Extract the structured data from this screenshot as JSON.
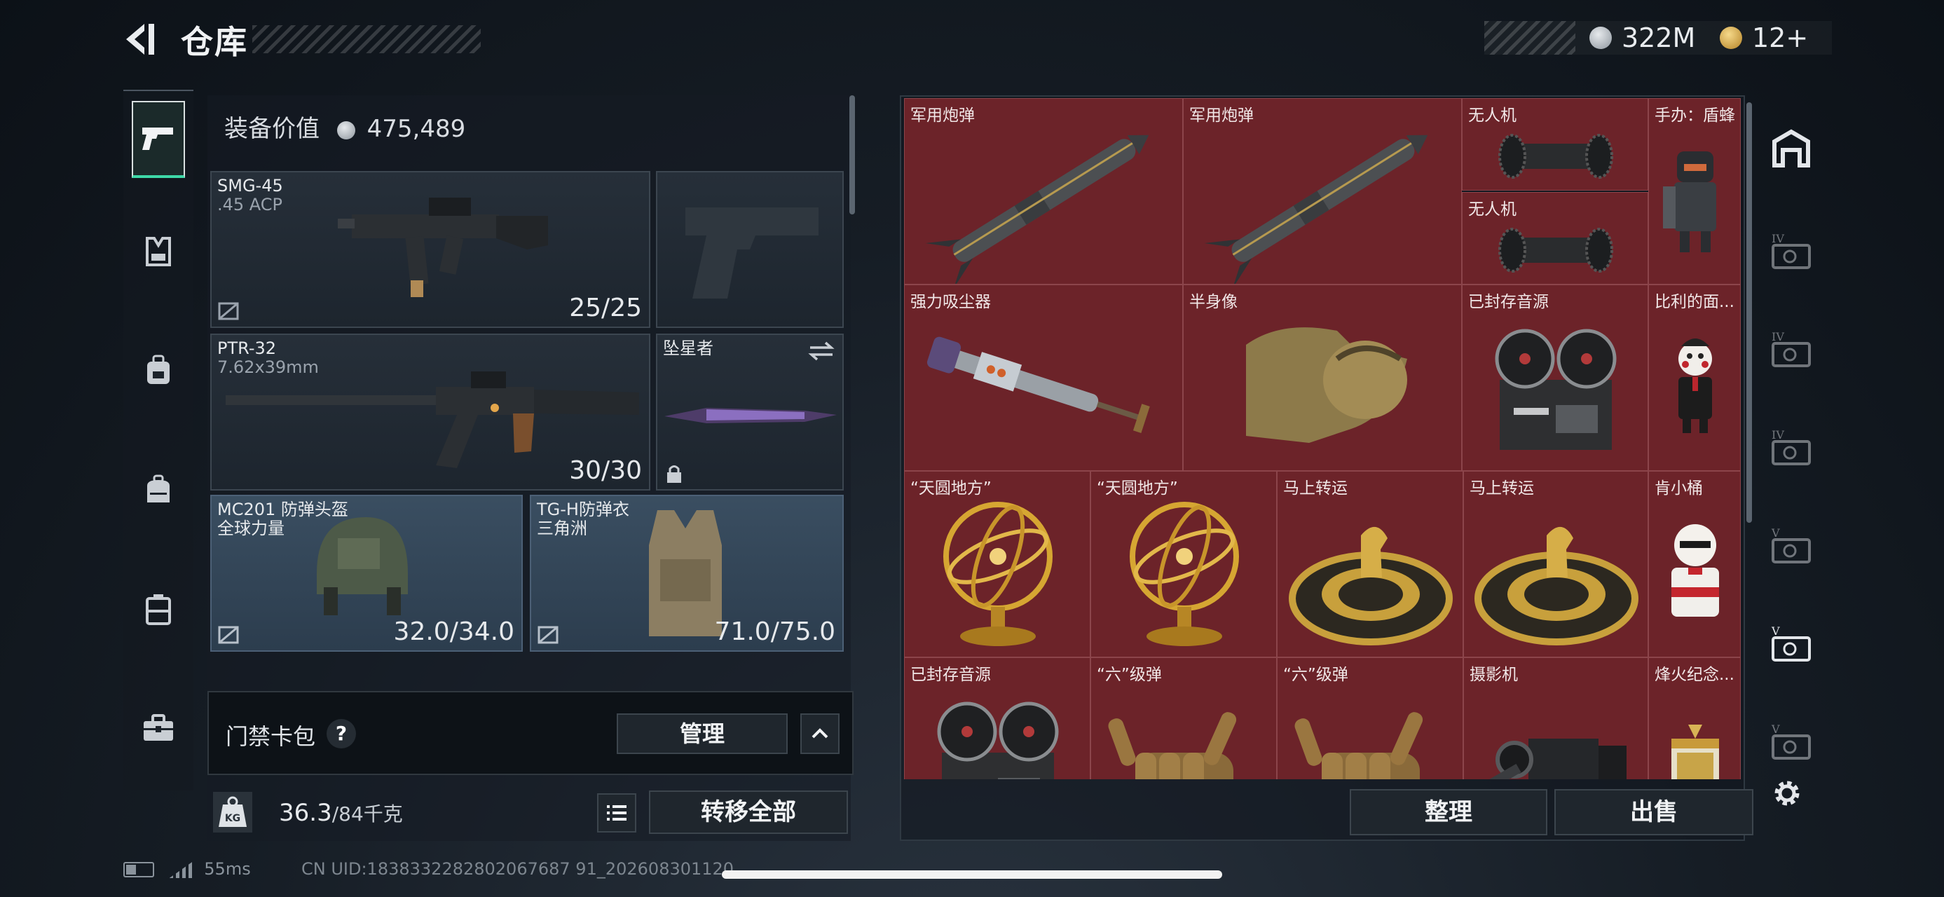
{
  "header": {
    "title": "仓库"
  },
  "currency": {
    "silver": "322M",
    "gold": "12+"
  },
  "colors": {
    "accent_green": "#3ed9a8",
    "item_red": "#6c2329",
    "slot_blue": "#3a4e61"
  },
  "left_nav": {
    "items": [
      "pistol-icon",
      "armor-icon",
      "backpack-icon",
      "bag-icon",
      "case-icon",
      "toolbox-icon"
    ],
    "active": "pistol-icon"
  },
  "equipment": {
    "value_label": "装备价值",
    "value": "475,489",
    "slots": [
      {
        "name": "SMG-45",
        "sub": ".45 ACP",
        "durability": "25/25"
      },
      {
        "name": "",
        "sub": "",
        "durability": ""
      },
      {
        "name": "PTR-32",
        "sub": "7.62x39mm",
        "durability": "30/30"
      },
      {
        "name": "坠星者",
        "sub": "",
        "durability": ""
      },
      {
        "name": "MC201 防弹头盔",
        "sub": "全球力量",
        "durability": "32.0/34.0"
      },
      {
        "name": "TG-H防弹衣",
        "sub": "三角洲",
        "durability": "71.0/75.0"
      }
    ]
  },
  "keycard": {
    "label": "门禁卡包",
    "help": "?",
    "manage": "管理"
  },
  "capacity": {
    "current": "36.3",
    "max": "/84千克",
    "kg_icon": "KG",
    "transfer_all": "转移全部"
  },
  "status": {
    "ping": "55ms",
    "uid": "CN UID:1838332282802067687 91_202608301120"
  },
  "inventory": {
    "items": [
      {
        "name": "军用炮弹",
        "icon": "missile"
      },
      {
        "name": "军用炮弹",
        "icon": "missile"
      },
      {
        "name": "无人机",
        "icon": "drone"
      },
      {
        "name": "无人机",
        "icon": "drone"
      },
      {
        "name": "手办：盾蜂",
        "icon": "figure"
      },
      {
        "name": "强力吸尘器",
        "icon": "vacuum"
      },
      {
        "name": "半身像",
        "icon": "bust"
      },
      {
        "name": "已封存音源",
        "icon": "reel"
      },
      {
        "name": "比利的面...",
        "icon": "puppet"
      },
      {
        "name": "“天圆地方”",
        "icon": "armillary"
      },
      {
        "name": "“天圆地方”",
        "icon": "armillary"
      },
      {
        "name": "马上转运",
        "icon": "horse-disc"
      },
      {
        "name": "马上转运",
        "icon": "horse-disc"
      },
      {
        "name": "肯小桶",
        "icon": "kfc"
      },
      {
        "name": "已封存音源",
        "icon": "reel"
      },
      {
        "name": "“六”级弹",
        "icon": "hand"
      },
      {
        "name": "“六”级弹",
        "icon": "hand"
      },
      {
        "name": "摄影机",
        "icon": "camera"
      },
      {
        "name": "烽火纪念...",
        "icon": "trophy"
      }
    ],
    "sort": "整理",
    "sell": "出售"
  },
  "right_nav": {
    "items": [
      "safe-icon",
      "case-iv-icon",
      "case-iv-2-icon",
      "case-iv-3-icon",
      "case-v-icon",
      "case-v-2-icon",
      "case-v-3-icon"
    ],
    "active": "case-v-2-icon"
  }
}
